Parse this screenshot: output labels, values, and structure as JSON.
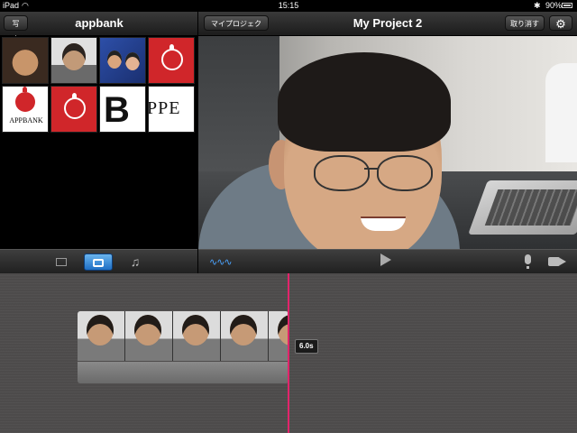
{
  "status_bar": {
    "device": "iPad",
    "time": "15:15",
    "battery": "90%"
  },
  "library_panel": {
    "back_button": "写真",
    "title": "appbank",
    "thumb_texts": {
      "appbank": "APPBANK",
      "b": "B",
      "ppe": "PPE"
    }
  },
  "project_panel": {
    "my_projects_button": "マイプロジェクト",
    "title": "My Project 2",
    "undo_button": "取り消す",
    "settings_icon": "⚙"
  },
  "timeline": {
    "clip_duration": "6.0s",
    "playhead_color": "#e2246b"
  },
  "icons": {
    "video": "video-icon",
    "photo": "camera-icon",
    "music": "♫",
    "waveform": "∿∿∿",
    "accent": "#4aa3ff"
  }
}
